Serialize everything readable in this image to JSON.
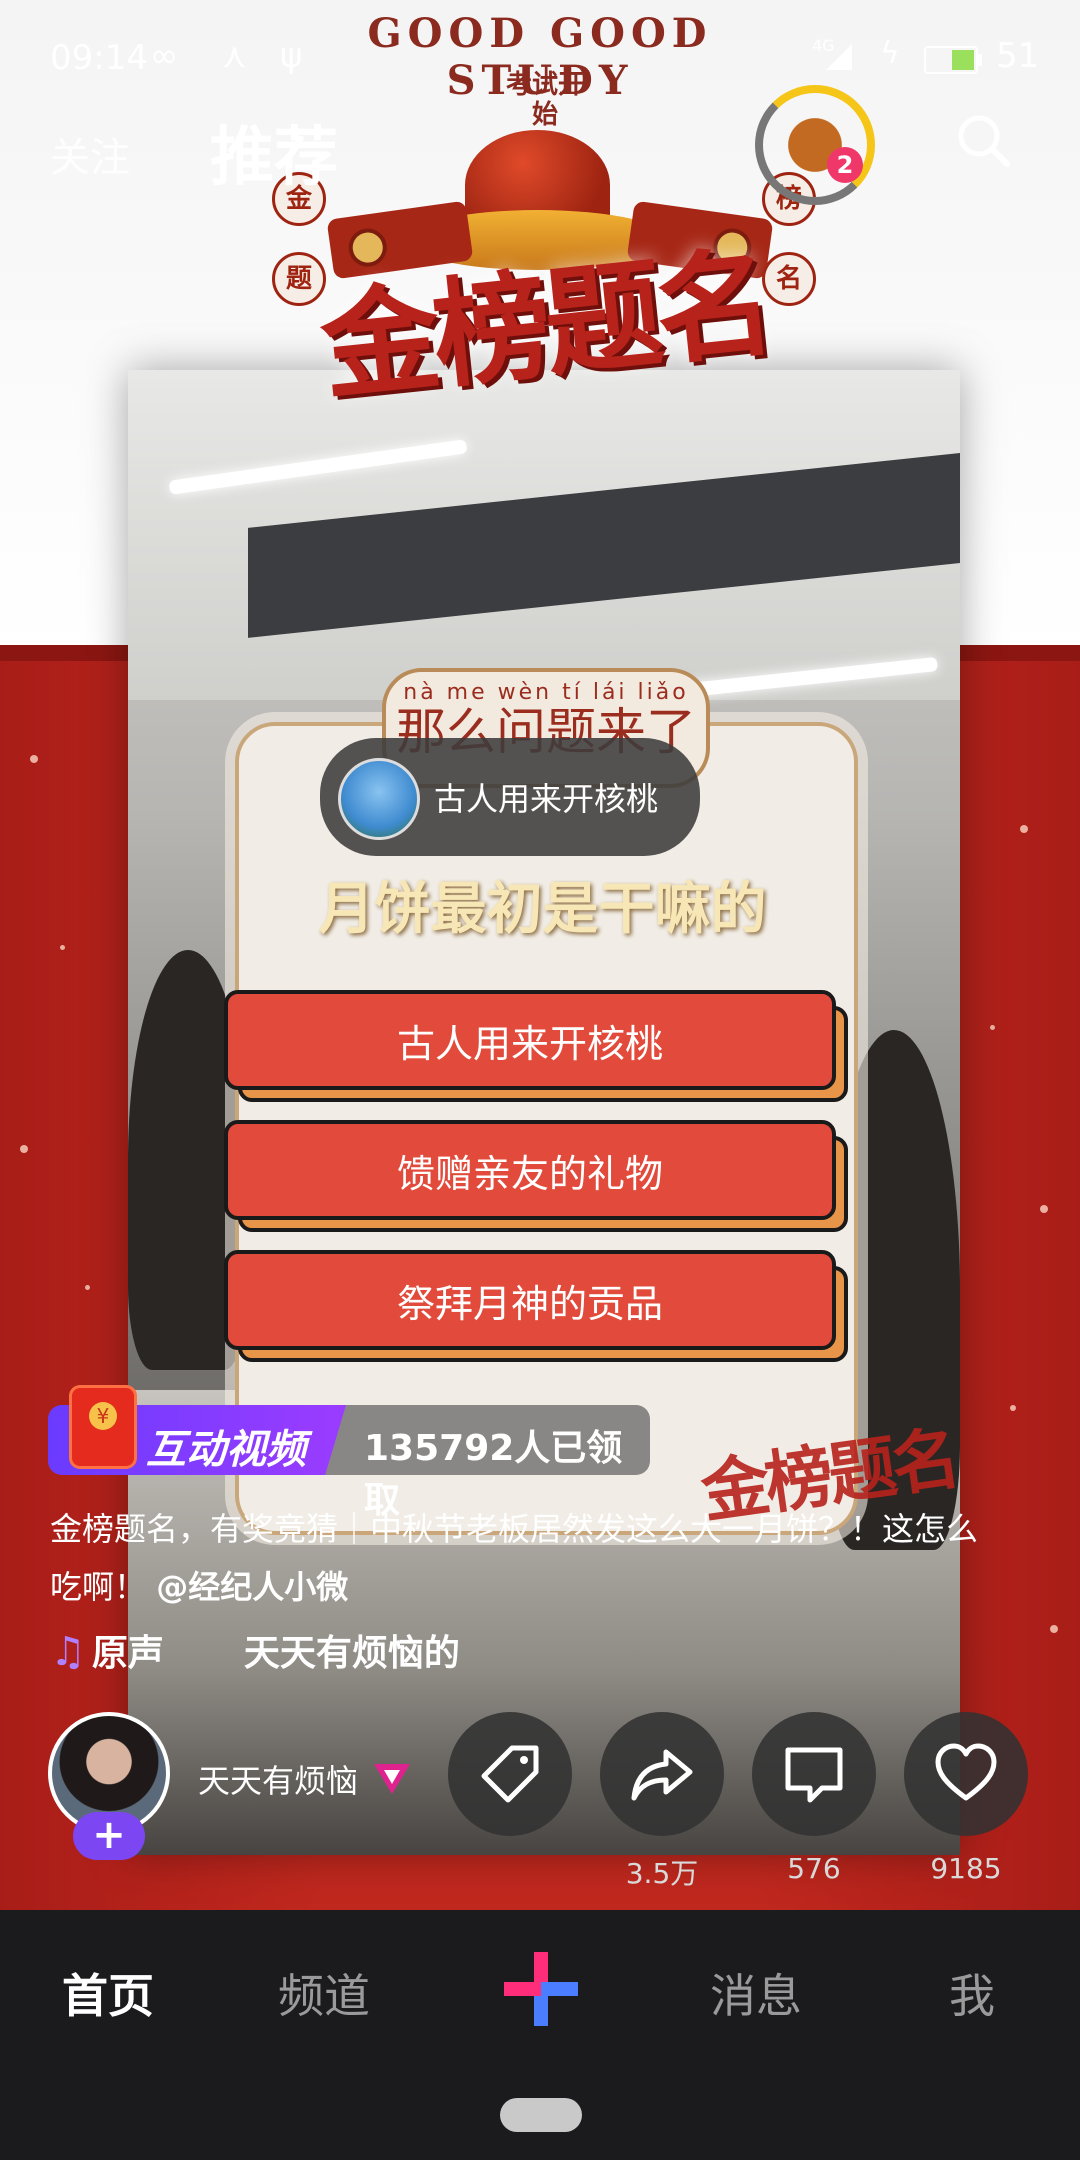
{
  "status_bar": {
    "time": "09:14",
    "network": "4G",
    "battery": "51"
  },
  "header": {
    "follow_tab": "关注",
    "recommend_tab": "推荐",
    "chest_badge": "2"
  },
  "banner": {
    "arc_text": "GOOD GOOD STUDY",
    "exam_text": "考试开始",
    "seals": [
      "金",
      "榜",
      "题",
      "名"
    ],
    "title": "金榜题名"
  },
  "quiz": {
    "header_pinyin": "nà me wèn tí lái liǎo",
    "header_text": "那么问题来了",
    "selected_answer": "古人用来开核桃",
    "question": "月饼最初是干嘛的",
    "options": [
      "古人用来开核桃",
      "馈赠亲友的礼物",
      "祭拜月神的贡品"
    ],
    "corner_logo": "金榜题名"
  },
  "interactive": {
    "label": "互动视频",
    "count": "135792人已领取"
  },
  "caption": {
    "text": "金榜题名，有奖竞猜｜中秋节老板居然发这么大一月饼？！这怎么吃啊！",
    "mention": "@经纪人小微"
  },
  "music": {
    "source": "原声",
    "song": "天天有烦恼的"
  },
  "author": {
    "name": "天天有烦恼"
  },
  "actions": {
    "share_count": "3.5万",
    "comment_count": "576",
    "like_count": "9185"
  },
  "bottom_nav": {
    "home": "首页",
    "channel": "频道",
    "messages": "消息",
    "me": "我"
  },
  "colors": {
    "accent_purple": "#7c46f2",
    "option_red": "#e24b3c",
    "banner_red": "#b7221b"
  }
}
